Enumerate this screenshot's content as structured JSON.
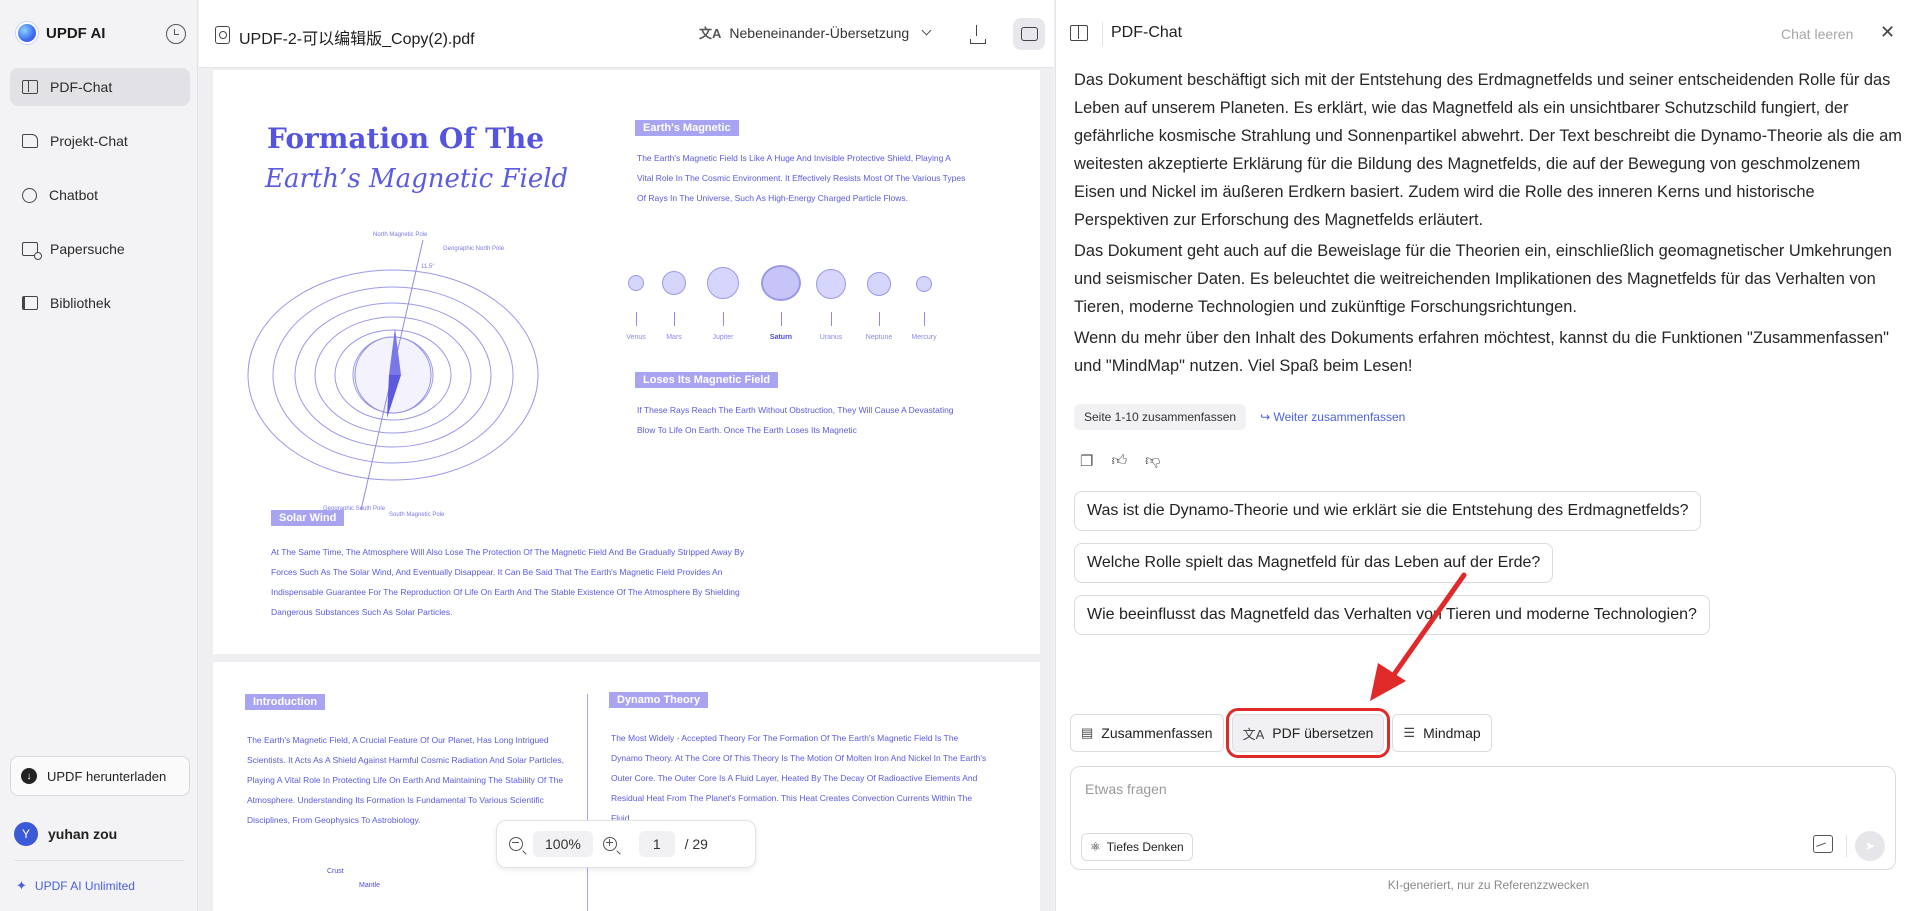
{
  "sidebar": {
    "brand": "UPDF AI",
    "items": [
      {
        "label": "PDF-Chat",
        "icon": "book-icon"
      },
      {
        "label": "Projekt-Chat",
        "icon": "folder-icon"
      },
      {
        "label": "Chatbot",
        "icon": "bot-icon"
      },
      {
        "label": "Papersuche",
        "icon": "search-doc-icon"
      },
      {
        "label": "Bibliothek",
        "icon": "library-icon"
      }
    ],
    "download_label": "UPDF herunterladen",
    "user_initial": "Y",
    "user_name": "yuhan zou",
    "plan": "UPDF AI Unlimited"
  },
  "viewer": {
    "doc_title": "UPDF-2-可以编辑版_Copy(2).pdf",
    "translation_mode": "Nebeneinander-Übersetzung",
    "page1": {
      "title_line1": "Formation Of The",
      "title_line2": "Earth’s Magnetic Field",
      "tag_magnetic": "Earth's Magnetic",
      "para_magnetic": "The Earth's Magnetic Field Is Like A Huge And Invisible Protective Shield, Playing A Vital Role In The Cosmic Environment. It Effectively Resists Most Of The Various Types Of Rays In The Universe, Such As High-Energy Charged Particle Flows.",
      "planets": [
        "Venus",
        "Mars",
        "Jupiter",
        "Saturn",
        "Uranus",
        "Neptune",
        "Mercury"
      ],
      "tag_loses": "Loses Its Magnetic Field",
      "para_loses": "If These Rays Reach The Earth Without Obstruction, They Will Cause A Devastating Blow To Life On Earth. Once The Earth Loses Its Magnetic",
      "diagram_labels": {
        "north_magnetic": "North Magnetic Pole",
        "geographic_north": "Geographic North Pole",
        "angle": "11.5°",
        "geographic_south": "Geographic South Pole",
        "south_magnetic": "South Magnetic Pole"
      },
      "tag_solar": "Solar Wind",
      "para_solar": "At The Same Time, The Atmosphere Will Also Lose The Protection Of The Magnetic Field And Be Gradually Stripped Away By Forces Such As The Solar Wind, And Eventually Disappear. It Can Be Said That The Earth's Magnetic Field Provides An Indispensable Guarantee For The Reproduction Of Life On Earth And The Stable Existence Of The Atmosphere By Shielding Dangerous Substances Such As Solar Particles."
    },
    "page2": {
      "tag_intro": "Introduction",
      "para_intro": "The Earth's Magnetic Field, A Crucial Feature Of Our Planet, Has Long Intrigued Scientists. It Acts As A Shield Against Harmful Cosmic Radiation And Solar Particles, Playing A Vital Role In Protecting Life On Earth And Maintaining The Stability Of The Atmosphere. Understanding Its Formation Is Fundamental To Various Scientific Disciplines, From Geophysics To Astrobiology.",
      "tag_dynamo": "Dynamo Theory",
      "para_dynamo": "The Most Widely - Accepted Theory For The Formation Of The Earth's Magnetic Field Is The Dynamo Theory. At The Core Of This Theory Is The Motion Of Molten Iron And Nickel In The Earth's Outer Core. The Outer Core Is A Fluid Layer, Heated By The Decay Of Radioactive Elements And Residual Heat From The Planet's Formation. This Heat Creates Convection Currents Within The Fluid.",
      "label_crust": "Crust",
      "label_mantle": "Mantle"
    },
    "zoom": {
      "value": "100%",
      "page": "1",
      "total": "/ 29"
    }
  },
  "chat": {
    "title": "PDF-Chat",
    "clear_label": "Chat leeren",
    "answer": [
      "Das Dokument beschäftigt sich mit der Entstehung des Erdmagnetfelds und seiner entscheidenden Rolle für das Leben auf unserem Planeten. Es erklärt, wie das Magnetfeld als ein unsichtbarer Schutzschild fungiert, der gefährliche kosmische Strahlung und Sonnenpartikel abwehrt. Der Text beschreibt die Dynamo-Theorie als die am weitesten akzeptierte Erklärung für die Bildung des Magnetfelds, die auf der Bewegung von geschmolzenem Eisen und Nickel im äußeren Erdkern basiert. Zudem wird die Rolle des inneren Kerns und historische Perspektiven zur Erforschung des Magnetfelds erläutert.",
      "Das Dokument geht auch auf die Beweislage für die Theorien ein, einschließlich geomagnetischer Umkehrungen und seismischer Daten. Es beleuchtet die weitreichenden Implikationen des Magnetfelds für das Verhalten von Tieren, moderne Technologien und zukünftige Forschungsrichtungen.",
      "Wenn du mehr über den Inhalt des Dokuments erfahren möchtest, kannst du die Funktionen \"Zusammenfassen\" und \"MindMap\" nutzen. Viel Spaß beim Lesen!"
    ],
    "summary_chip": "Seite 1-10 zusammenfassen",
    "continue_link": "Weiter zusammenfassen",
    "suggestions": [
      "Was ist die Dynamo-Theorie und wie erklärt sie die Entstehung des Erdmagnetfelds?",
      "Welche Rolle spielt das Magnetfeld für das Leben auf der Erde?",
      "Wie beeinflusst das Magnetfeld das Verhalten von Tieren und moderne Technologien?"
    ],
    "tools": {
      "summarize": "Zusammenfassen",
      "translate": "PDF übersetzen",
      "mindmap": "Mindmap"
    },
    "input_placeholder": "Etwas fragen",
    "deep_think": "Tiefes Denken",
    "disclaimer": "KI-generiert, nur zu Referenzzwecken",
    "highlight_color": "#e02a2a"
  }
}
